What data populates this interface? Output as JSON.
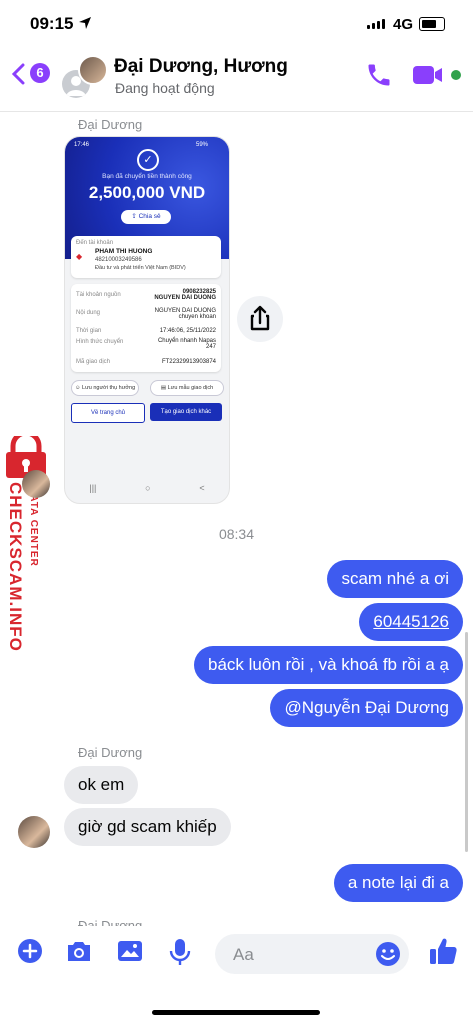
{
  "status_bar": {
    "time": "09:15",
    "network": "4G"
  },
  "header": {
    "back_badge": "6",
    "title": "Đại Dương, Hương",
    "subtitle": "Đang hoạt động"
  },
  "watermark": {
    "brand": "CHECKSCAM.INFO",
    "tag": "DATA CENTER"
  },
  "image_message": {
    "sender": "Đại Dương",
    "status_time": "17:46",
    "status_battery": "59%",
    "success_text": "Bạn đã chuyển tiền thành công",
    "amount": "2,500,000 VND",
    "share_label": "Chia sẻ",
    "recipient_label": "Đến tài khoản",
    "recipient_name": "PHAM THI HUONG",
    "recipient_account": "48210003249586",
    "recipient_bank": "Đầu tư và phát triển Việt Nam (BIDV)",
    "rows": [
      {
        "label": "Tài khoản nguồn",
        "value": "0908232825\nNGUYEN DAI DUONG"
      },
      {
        "label": "Nội dung",
        "value": "NGUYEN DAI DUONG chuyen khoan"
      },
      {
        "label": "Thời gian",
        "value": "17:46:06, 25/11/2022"
      },
      {
        "label": "Hình thức chuyển",
        "value": "Chuyển nhanh Napas 247"
      },
      {
        "label": "Mã giao dịch",
        "value": "FT22329913903874"
      }
    ],
    "save_beneficiary": "Lưu người thụ hưởng",
    "save_template": "Lưu mẫu giao dịch",
    "home_button": "Về trang chủ",
    "new_transaction_button": "Tạo giao dịch khác",
    "nav_icons": [
      "|||",
      "○",
      "<"
    ]
  },
  "time_separator": "08:34",
  "outgoing_1": [
    "scam nhé a ơi",
    "60445126",
    "báck luôn rồi , và khoá fb rồi a ạ",
    "@Nguyễn Đại Dương"
  ],
  "incoming": {
    "sender": "Đại Dương",
    "messages": [
      "ok em",
      "giờ gd scam khiếp"
    ]
  },
  "outgoing_2": [
    "a note lại đi a"
  ],
  "next_sender": "Đại Dương",
  "composer": {
    "placeholder": "Aa"
  },
  "colors": {
    "accent": "#3e5bf0",
    "purple": "#8a3ffc",
    "online": "#31a24c",
    "watermark": "#d8262e"
  }
}
